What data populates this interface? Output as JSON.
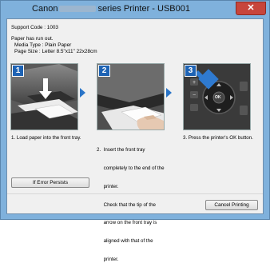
{
  "window": {
    "title_left": "Canon",
    "title_right": "series Printer - USB001",
    "close_glyph": "✕"
  },
  "info": {
    "support_code": "Support Code : 1003",
    "message": "Paper has run out.",
    "media_type": "Media Type : Plain Paper",
    "page_size": "Page Size : Letter 8.5\"x11\" 22x28cm"
  },
  "steps": [
    {
      "number": "1",
      "lines": [
        "1.  Load paper into the front tray."
      ]
    },
    {
      "number": "2",
      "lines": [
        "2.  Insert the front tray",
        "     completely to the end of the",
        "     printer.",
        "     Check that the tip of the",
        "     arrow on the front tray is",
        "     aligned with that of the",
        "     printer."
      ]
    },
    {
      "number": "3",
      "lines": [
        "3.  Press the printer's OK button."
      ]
    }
  ],
  "panel3_ok": "OK",
  "buttons": {
    "if_error": "If Error Persists",
    "cancel": "Cancel Printing"
  }
}
